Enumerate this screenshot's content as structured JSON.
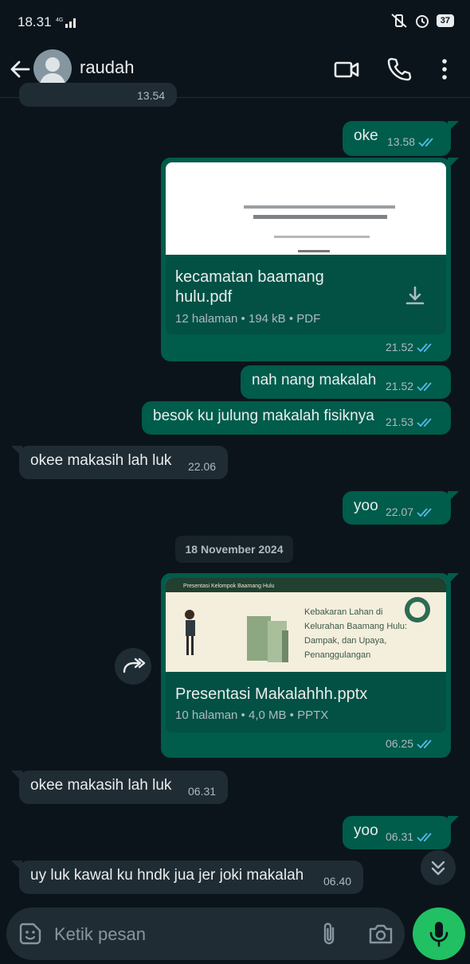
{
  "status_bar": {
    "time": "18.31",
    "network": "4G",
    "battery": "37"
  },
  "header": {
    "contact_name": "raudah"
  },
  "messages": {
    "partial_time": "13.54",
    "m1": {
      "text": "oke",
      "time": "13.58"
    },
    "doc1": {
      "name_line1": "kecamatan baamang",
      "name_line2": "hulu.pdf",
      "info": "12 halaman • 194 kB • PDF",
      "time": "21.52"
    },
    "m2": {
      "text": "nah nang makalah",
      "time": "21.52"
    },
    "m3": {
      "text": "besok ku julung makalah fisiknya",
      "time": "21.53"
    },
    "m4": {
      "text": "okee makasih lah luk",
      "time": "22.06"
    },
    "m5": {
      "text": "yoo",
      "time": "22.07"
    },
    "date_divider": "18 November 2024",
    "doc2": {
      "name": "Presentasi Makalahhh.pptx",
      "info": "10 halaman • 4,0 MB • PPTX",
      "time": "06.25",
      "slide_header": "Presentasi Kelompok Baamang Hulu",
      "slide_title_1": "Kebakaran Lahan di",
      "slide_title_2": "Kelurahan Baamang Hulu:",
      "slide_title_3": "Dampak, dan Upaya,",
      "slide_title_4": "Penanggulangan"
    },
    "m6": {
      "text": "okee makasih lah luk",
      "time": "06.31"
    },
    "m7": {
      "text": "yoo",
      "time": "06.31"
    },
    "m8": {
      "text": "uy luk kawal ku hndk jua jer joki makalah",
      "time": "06.40"
    }
  },
  "composer": {
    "placeholder": "Ketik pesan"
  },
  "colors": {
    "outgoing": "#005c4b",
    "incoming": "#202c33",
    "background": "#0b141a",
    "accent": "#21c063",
    "read_tick": "#53bdeb"
  },
  "icons": [
    "back-arrow-icon",
    "video-call-icon",
    "phone-icon",
    "more-vert-icon",
    "download-icon",
    "forward-icon",
    "chevron-double-down-icon",
    "sticker-icon",
    "paperclip-icon",
    "camera-icon",
    "mic-icon"
  ]
}
